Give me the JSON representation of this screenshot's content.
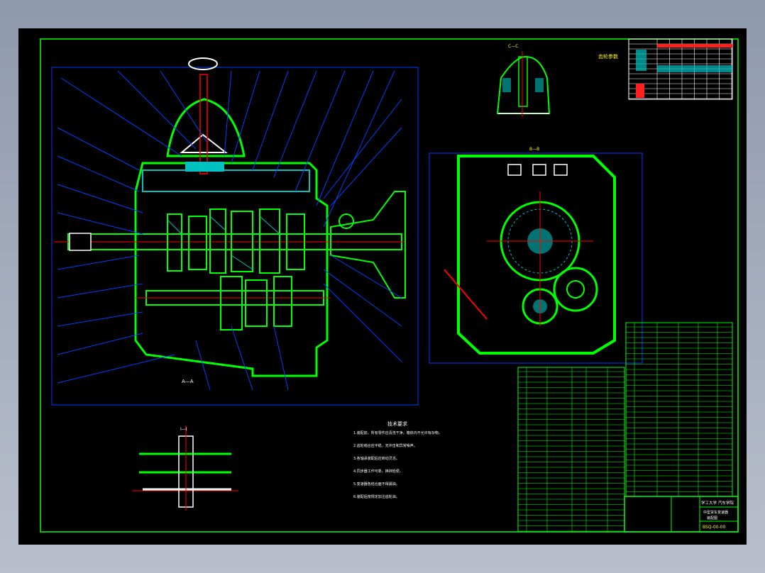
{
  "drawing": {
    "section_labels": {
      "main": "A—A",
      "top_right": "C—C",
      "side": "B—B",
      "detail": "I—I"
    },
    "table_caption": "齿轮参数",
    "notes_title": "技术要求",
    "notes": [
      "1.装配前，所有零件应清洗干净，箱体内不允许有杂物。",
      "2.齿轮啮合应平稳，无冲击和异常噪声。",
      "3.各轴承装配后应转动灵活。",
      "4.同步器工作可靠，换挡轻便。",
      "5.变速器各结合面不得漏油。",
      "6.装配后按规定加注齿轮油。"
    ],
    "title_block": {
      "school": "学工大学 汽车学院",
      "title": "中型货车变速器",
      "subtitle": "装配图",
      "drawing_no": "BSQ-00-00"
    },
    "colors": {
      "background": "#000000",
      "frame": "#00ff00",
      "leader": "#0040ff",
      "centerline": "#ff0000",
      "hatch": "#00c0c0",
      "text": "#ffffff",
      "highlight": "#ffff00"
    }
  }
}
